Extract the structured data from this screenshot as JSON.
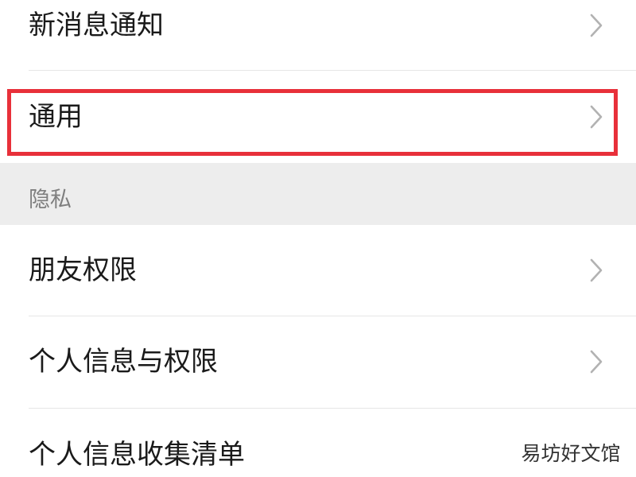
{
  "settings": {
    "items": [
      {
        "label": "新消息通知"
      },
      {
        "label": "通用"
      }
    ],
    "privacy_section": {
      "title": "隐私",
      "items": [
        {
          "label": "朋友权限"
        },
        {
          "label": "个人信息与权限"
        },
        {
          "label": "个人信息收集清单"
        }
      ]
    }
  },
  "icons": {
    "row_chevron": "chevron-right-icon"
  },
  "colors": {
    "page_background": "#ededed",
    "card_background": "#ffffff",
    "highlight_border": "#e8303a",
    "chevron": "#b2b2b2",
    "section_title": "#7f7f7f"
  },
  "watermark": {
    "text": "易坊好文馆"
  }
}
